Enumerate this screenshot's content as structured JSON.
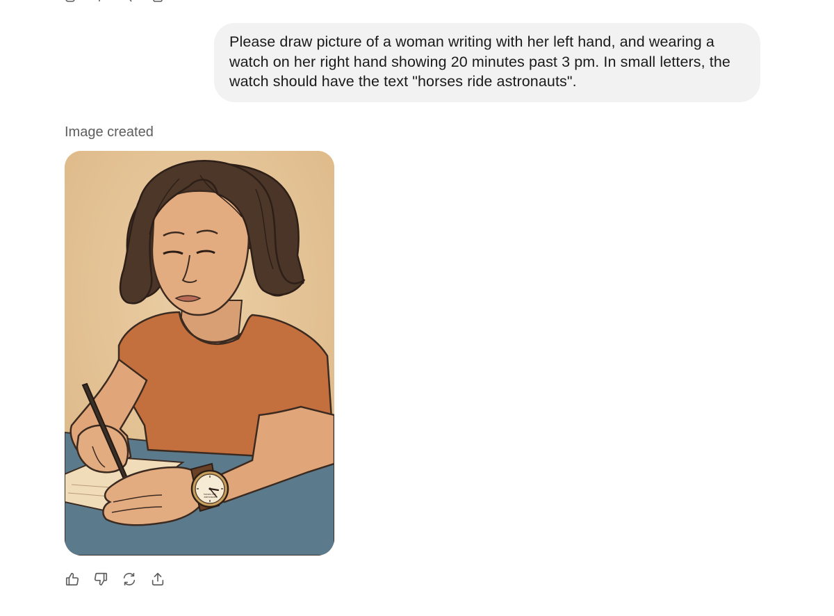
{
  "conversation": {
    "user_message": "Please draw picture of a woman writing with her left hand, and wearing a watch on her right hand showing 20 minutes past 3 pm. In small letters, the watch should have the text \"horses ride astronauts\".",
    "assistant_status": "Image created",
    "watch_text_line_1": "horses ride",
    "watch_text_line_2": "astronauts"
  },
  "top_actions": {
    "icons": [
      "copy-icon",
      "thumbs-up-icon",
      "thumbs-down-icon",
      "share-icon"
    ]
  },
  "message_actions": {
    "icons": [
      "thumbs-up-icon",
      "thumbs-down-icon",
      "regenerate-icon",
      "share-icon"
    ]
  },
  "colors": {
    "user_bubble_bg": "#f2f2f2",
    "status_text": "#5d5d5d",
    "icon_stroke": "#5d5d5d"
  }
}
